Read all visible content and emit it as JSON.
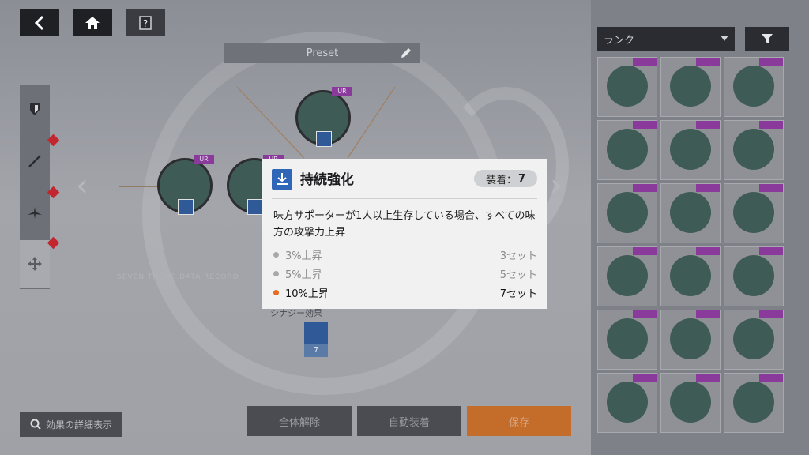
{
  "header": {
    "back_icon": "chevron-left-icon",
    "home_icon": "home-icon",
    "help_icon": "help-icon"
  },
  "preset": {
    "label": "Preset",
    "edit_icon": "pencil-icon"
  },
  "sidebar": {
    "items": [
      {
        "icon": "shield-icon",
        "alert": false
      },
      {
        "icon": "sword-icon",
        "alert": true
      },
      {
        "icon": "plane-icon",
        "alert": true
      },
      {
        "icon": "move-arrows-icon",
        "alert": true,
        "active": true
      }
    ]
  },
  "slots": [
    {
      "rank": "UR"
    },
    {
      "rank": "UR"
    },
    {
      "rank": "UR"
    }
  ],
  "caption_text": "SEVEN THEME DATA RECORD",
  "set_effect": {
    "label": "シナジー効果",
    "count": "7"
  },
  "footer": {
    "detail_label": "効果の詳細表示",
    "release_all": "全体解除",
    "auto_equip": "自動装着",
    "save": "保存"
  },
  "right_panel": {
    "rank_select": "ランク",
    "filter_icon": "filter-icon",
    "cards": [
      {
        "rank": "UR",
        "color": "purple"
      },
      {
        "rank": "SSR",
        "color": "purple"
      },
      {
        "rank": "SSR",
        "color": "purple"
      },
      {
        "rank": "SSR",
        "color": "purple"
      },
      {
        "rank": "SSR",
        "color": "purple"
      },
      {
        "rank": "SSR",
        "color": "purple"
      },
      {
        "rank": "SSR",
        "color": "purple"
      },
      {
        "rank": "SSR",
        "color": "purple"
      },
      {
        "rank": "SSR",
        "color": "purple"
      },
      {
        "rank": "SSR",
        "color": "purple"
      },
      {
        "rank": "SSR",
        "color": "purple"
      },
      {
        "rank": "SSR",
        "color": "purple"
      },
      {
        "rank": "SSR",
        "color": "purple"
      },
      {
        "rank": "SSR",
        "color": "purple"
      },
      {
        "rank": "SSR",
        "color": "purple"
      },
      {
        "rank": "SSR",
        "color": "purple"
      },
      {
        "rank": "SSR",
        "color": "purple"
      },
      {
        "rank": "SSR",
        "color": "purple"
      }
    ]
  },
  "modal": {
    "title": "持続強化",
    "equip_label": "装着：",
    "equip_count": "7",
    "description": "味方サポーターが1人以上生存している場合、すべての味方の攻撃力上昇",
    "tiers": [
      {
        "effect": "3%上昇",
        "req": "3セット",
        "active": false
      },
      {
        "effect": "5%上昇",
        "req": "5セット",
        "active": false
      },
      {
        "effect": "10%上昇",
        "req": "7セット",
        "active": true
      }
    ],
    "colors": {
      "active_dot": "#e86a1d",
      "inactive_dot": "#a8a8a8",
      "icon_bg": "#2f66b8"
    }
  }
}
